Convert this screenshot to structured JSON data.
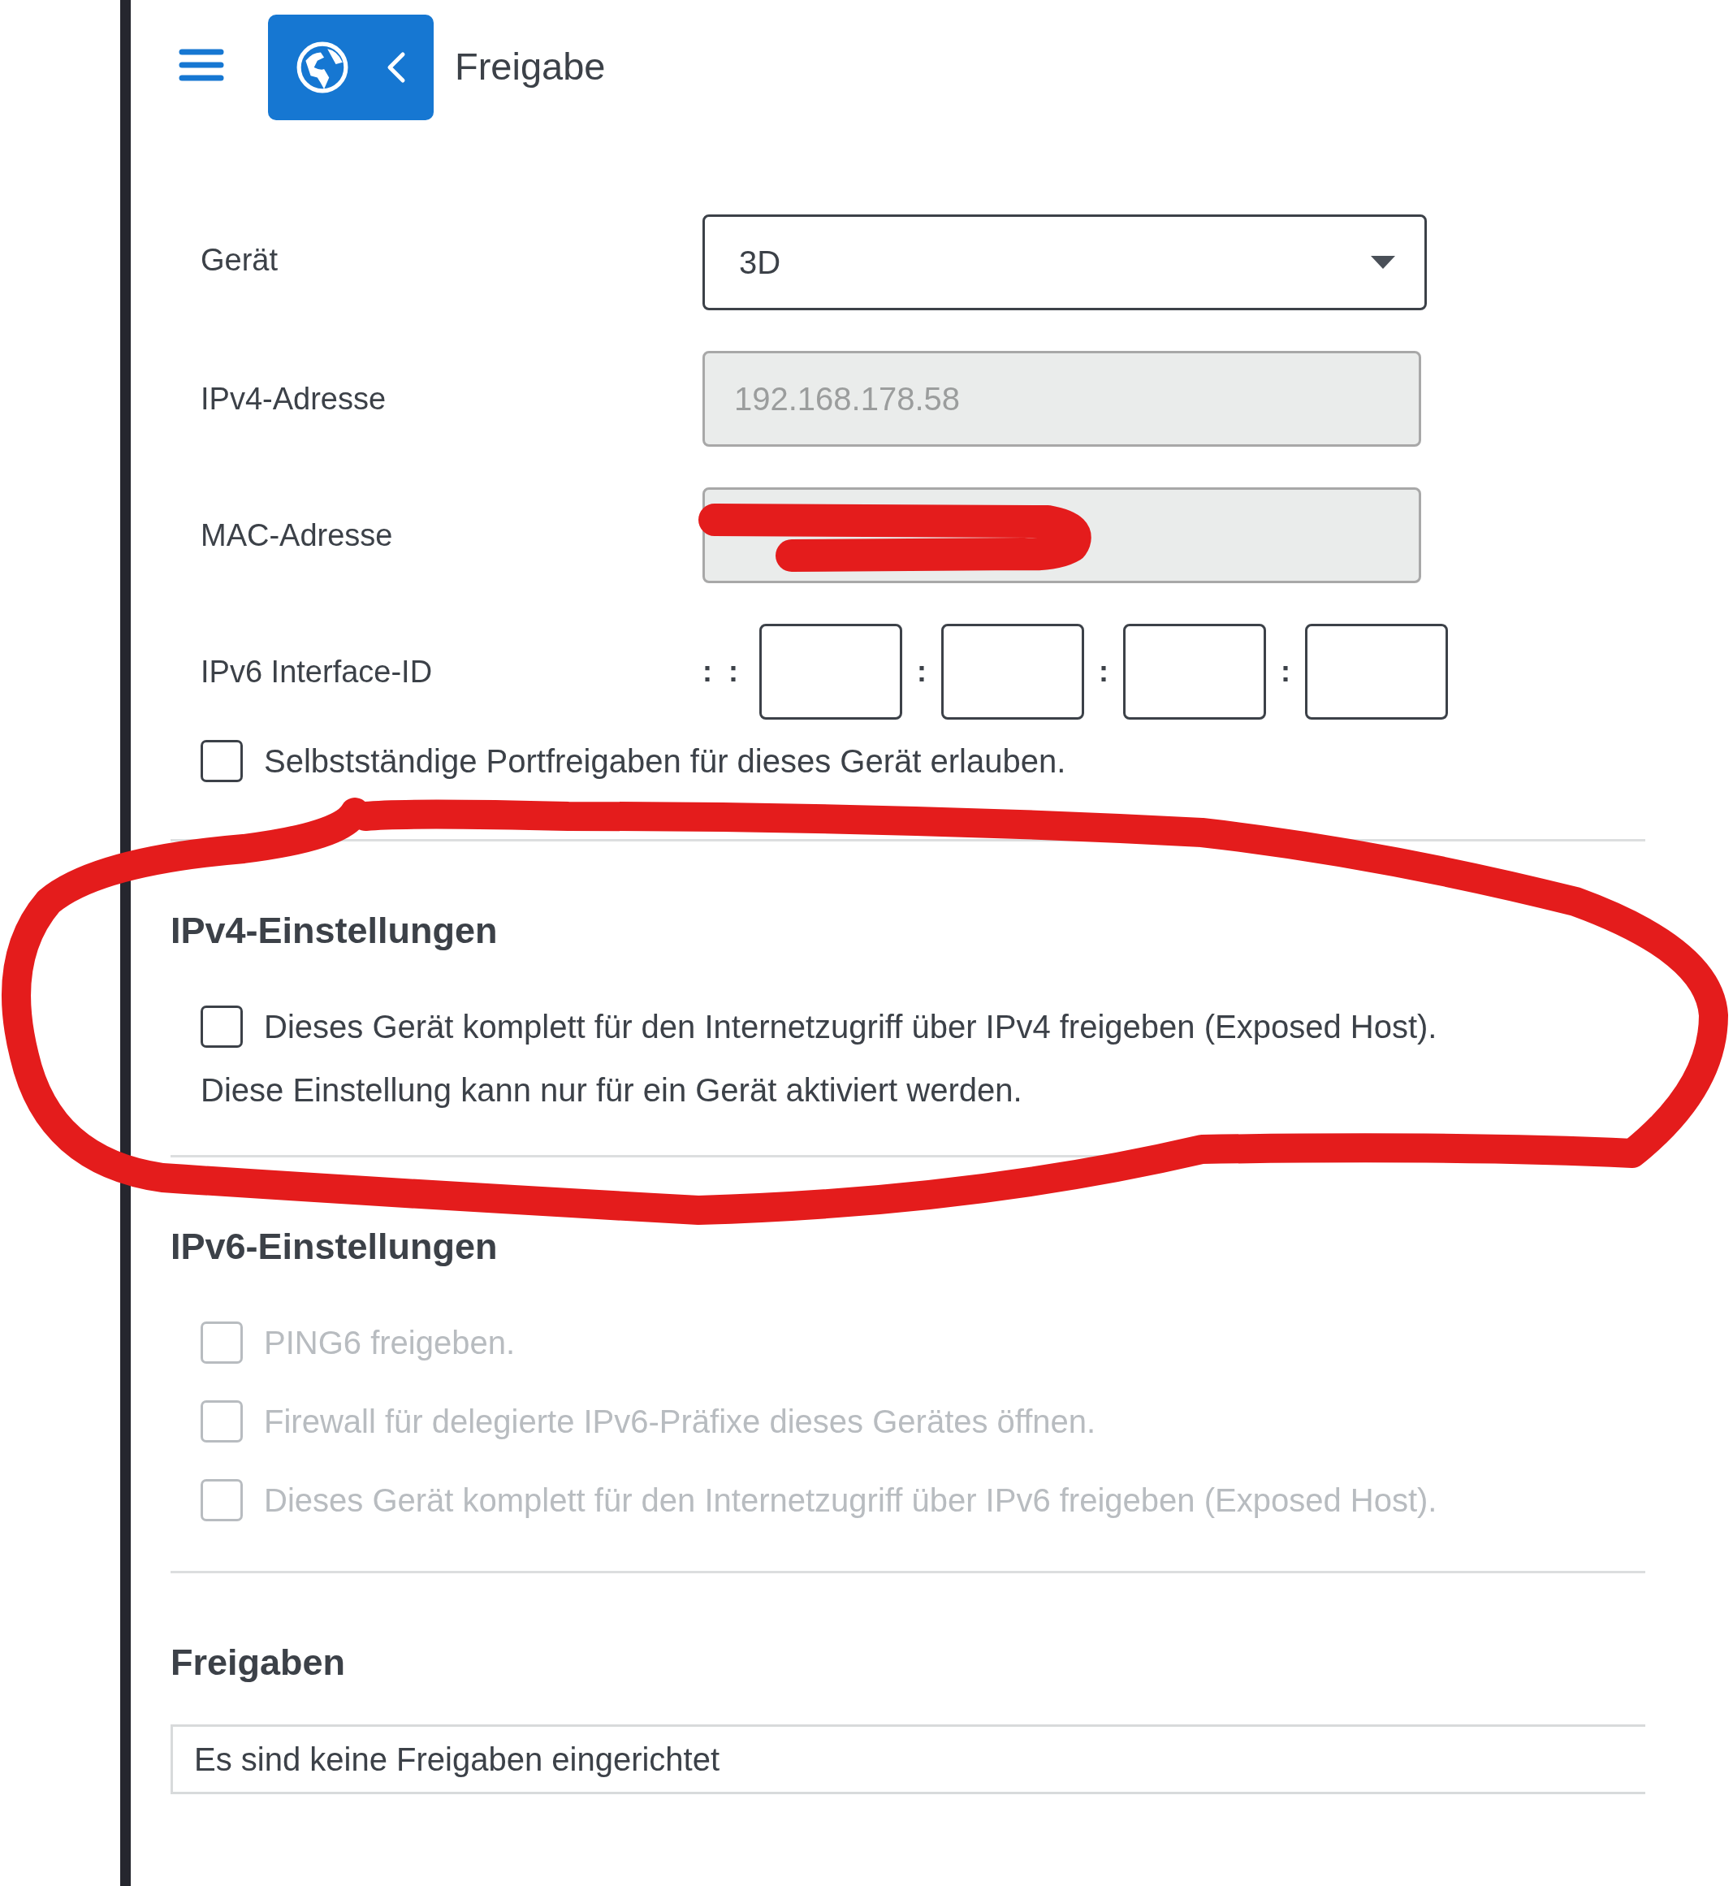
{
  "header": {
    "title": "Freigabe"
  },
  "form": {
    "fields": [
      {
        "kind": "select",
        "label": "Gerät",
        "value": "3D"
      },
      {
        "kind": "readonly",
        "label": "IPv4-Adresse",
        "value": "192.168.178.58"
      },
      {
        "kind": "readonly",
        "label": "MAC-Adresse",
        "scribbled_over": true
      },
      {
        "kind": "ipv6",
        "label": "IPv6 Interface-ID",
        "prefix": ": :",
        "separators": [
          ":",
          ":",
          ":"
        ]
      }
    ],
    "port_sharing": {
      "label": "Selbstständige Portfreigaben für dieses Gerät erlauben.",
      "checked": false,
      "disabled": false
    }
  },
  "sections": [
    {
      "title": "IPv4-Einstellungen",
      "options": [
        {
          "label": "Dieses Gerät komplett für den Internetzugriff über IPv4 freigeben (Exposed Host).",
          "checked": false,
          "disabled": false
        }
      ],
      "note": "Diese Einstellung kann nur für ein Gerät aktiviert werden.",
      "circled": true
    },
    {
      "title": "IPv6-Einstellungen",
      "options": [
        {
          "label": "PING6 freigeben.",
          "checked": false,
          "disabled": true
        },
        {
          "label": "Firewall für delegierte IPv6-Präfixe dieses Gerätes öffnen.",
          "checked": false,
          "disabled": true
        },
        {
          "label": "Dieses Gerät komplett für den Internetzugriff über IPv6 freigeben (Exposed Host).",
          "checked": false,
          "disabled": true
        }
      ]
    }
  ],
  "shares": {
    "title": "Freigaben",
    "empty_text": "Es sind keine Freigaben eingerichtet"
  }
}
